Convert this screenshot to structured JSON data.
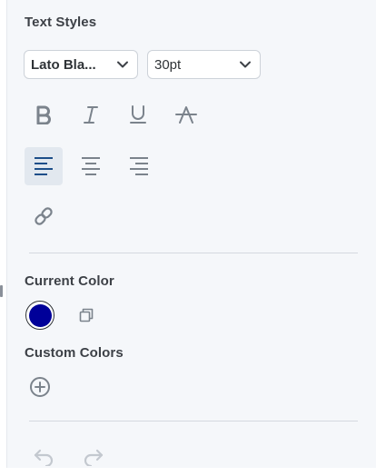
{
  "panel": {
    "text_styles_title": "Text Styles",
    "font_family": {
      "selected": "Lato Bla..."
    },
    "font_size": {
      "selected": "30pt"
    },
    "format_buttons": [
      {
        "name": "bold",
        "icon": "bold-icon",
        "active": false
      },
      {
        "name": "italic",
        "icon": "italic-icon",
        "active": false
      },
      {
        "name": "underline",
        "icon": "underline-icon",
        "active": false
      },
      {
        "name": "strikethrough",
        "icon": "strikethrough-icon",
        "active": false
      }
    ],
    "alignment": {
      "options": [
        "left",
        "center",
        "right"
      ],
      "selected": "left"
    },
    "link_icon": "link-icon",
    "current_color_title": "Current Color",
    "current_color": "#000099",
    "custom_colors_title": "Custom Colors",
    "add_color_icon": "plus-circle-icon",
    "history": {
      "undo_icon": "undo-icon",
      "redo_icon": "redo-icon",
      "undo_enabled": false,
      "redo_enabled": false
    }
  },
  "colors": {
    "icon": "#7b838c",
    "active_icon": "#1d4e89",
    "active_bg": "#e2e8ef",
    "disabled": "#c3c8cf"
  }
}
